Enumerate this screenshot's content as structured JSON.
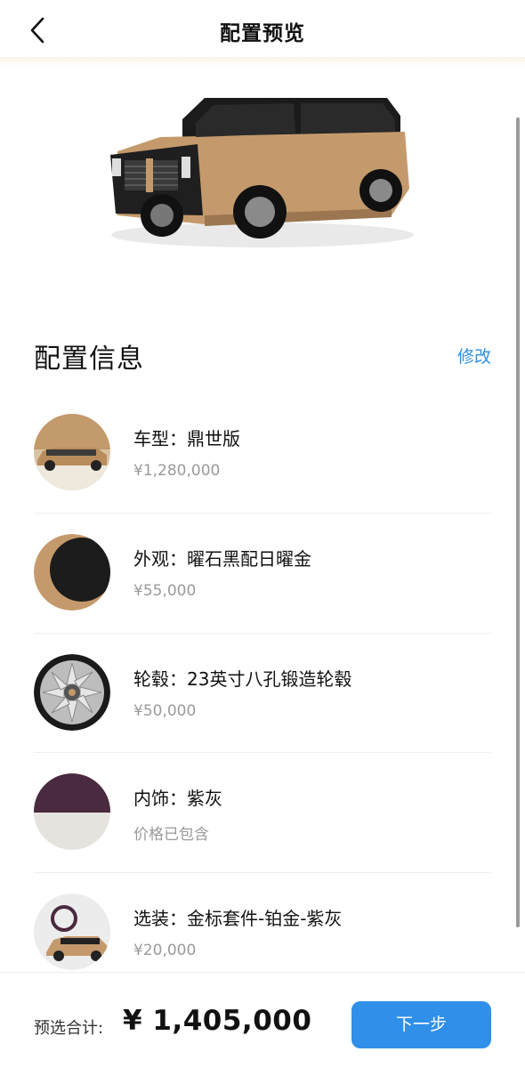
{
  "nav": {
    "title": "配置预览",
    "back_icon": "chevron-left-icon"
  },
  "section": {
    "title": "配置信息",
    "edit_label": "修改"
  },
  "items": [
    {
      "name": "车型：鼎世版",
      "price": "¥1,280,000",
      "thumb": "vehicle-side-thumb"
    },
    {
      "name": "外观：曜石黑配日曜金",
      "price": "¥55,000",
      "thumb": "color-swatch-black-gold"
    },
    {
      "name": "轮毂：23英寸八孔锻造轮毂",
      "price": "¥50,000",
      "thumb": "wheel-thumb"
    },
    {
      "name": "内饰：紫灰",
      "price": "价格已包含",
      "thumb": "interior-swatch-purple-grey"
    },
    {
      "name": "选装：金标套件-铂金-紫灰",
      "price": "¥20,000",
      "thumb": "option-package-thumb"
    }
  ],
  "footer": {
    "total_label": "预选合计:",
    "total_value": "¥ 1,405,000",
    "next_label": "下一步"
  },
  "colors": {
    "accent": "#2f8fe9",
    "gold": "#c49a6c",
    "muted_text": "#9a9a9a"
  }
}
